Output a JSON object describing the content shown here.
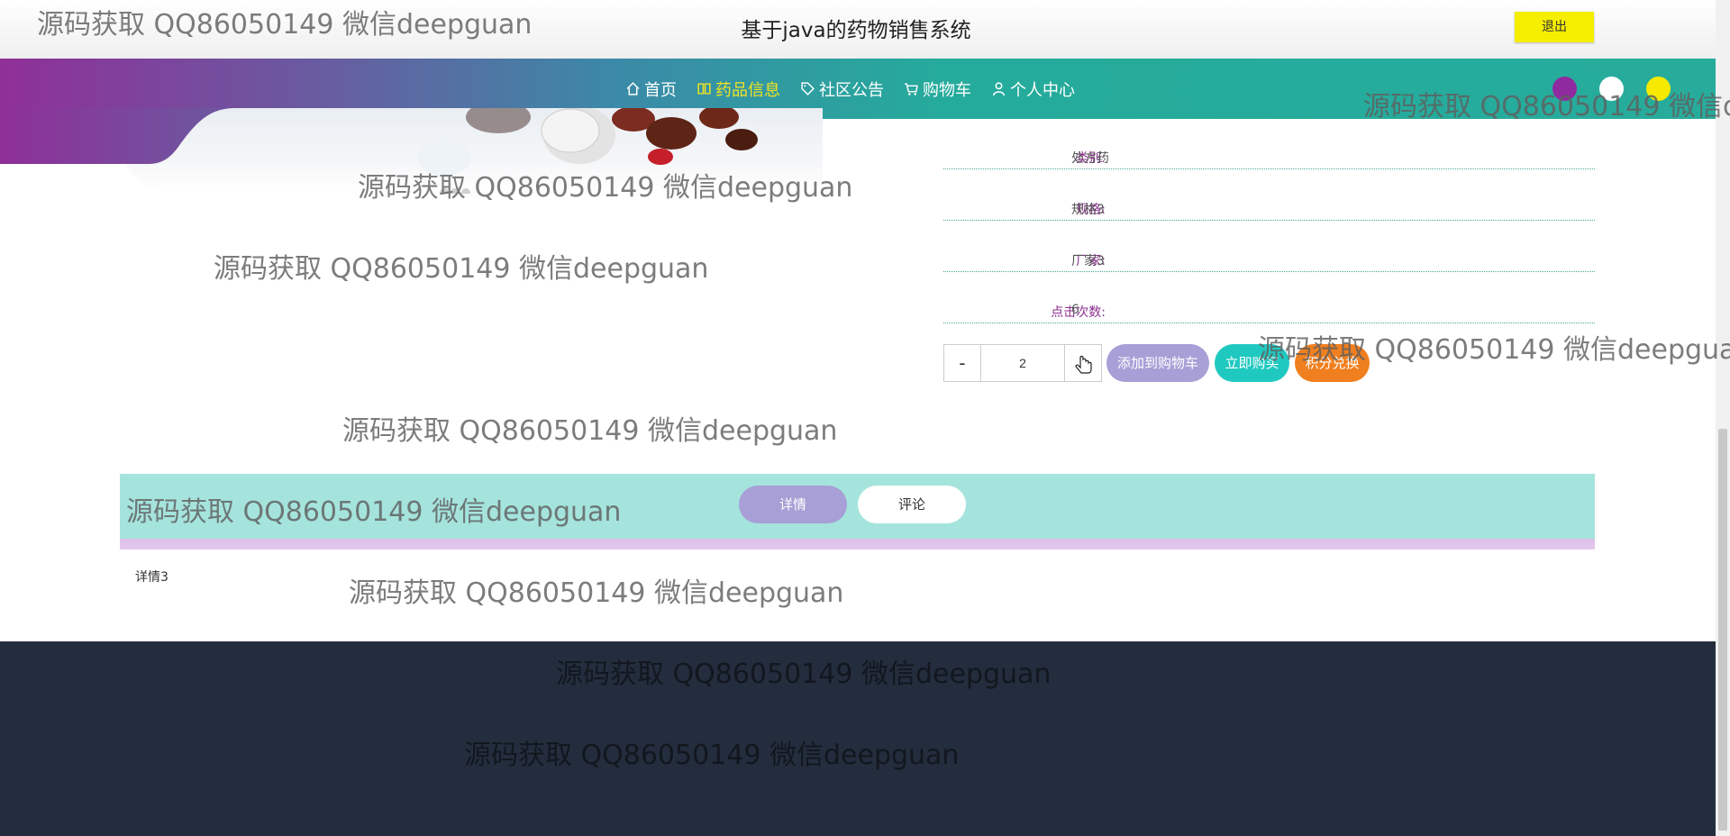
{
  "header": {
    "site_title": "基于java的药物销售系统",
    "logout_label": "退出"
  },
  "nav": {
    "items": [
      {
        "label": "首页",
        "icon": "home-icon",
        "active": false
      },
      {
        "label": "药品信息",
        "icon": "book-icon",
        "active": true
      },
      {
        "label": "社区公告",
        "icon": "tag-icon",
        "active": false
      },
      {
        "label": "购物车",
        "icon": "cart-icon",
        "active": false
      },
      {
        "label": "个人中心",
        "icon": "user-icon",
        "active": false
      }
    ],
    "theme_dots": [
      "#8f2aa0",
      "#ffffff",
      "#f7ea00"
    ]
  },
  "product": {
    "fields": [
      {
        "label": "类别:",
        "value": "处方药"
      },
      {
        "label": "规格:",
        "value": "规格3"
      },
      {
        "label": "厂家:",
        "value": "厂家3"
      },
      {
        "label": "点击次数:",
        "value": "6"
      }
    ],
    "quantity": "2",
    "minus_label": "-",
    "add_cart_label": "添加到购物车",
    "buy_now_label": "立即购买",
    "points_label": "积分兑换"
  },
  "tabs": {
    "detail_label": "详情",
    "comment_label": "评论"
  },
  "detail": {
    "text": "详情3"
  },
  "watermark": {
    "text": "源码获取 QQ86050149 微信deepguan"
  },
  "colors": {
    "accent_purple": "#a79fd6",
    "accent_teal": "#20c9c0",
    "accent_orange": "#f07f1f",
    "label_purple": "#8d2f8f",
    "logout_yellow": "#f5ee00",
    "footer_dark": "#232d3d"
  }
}
